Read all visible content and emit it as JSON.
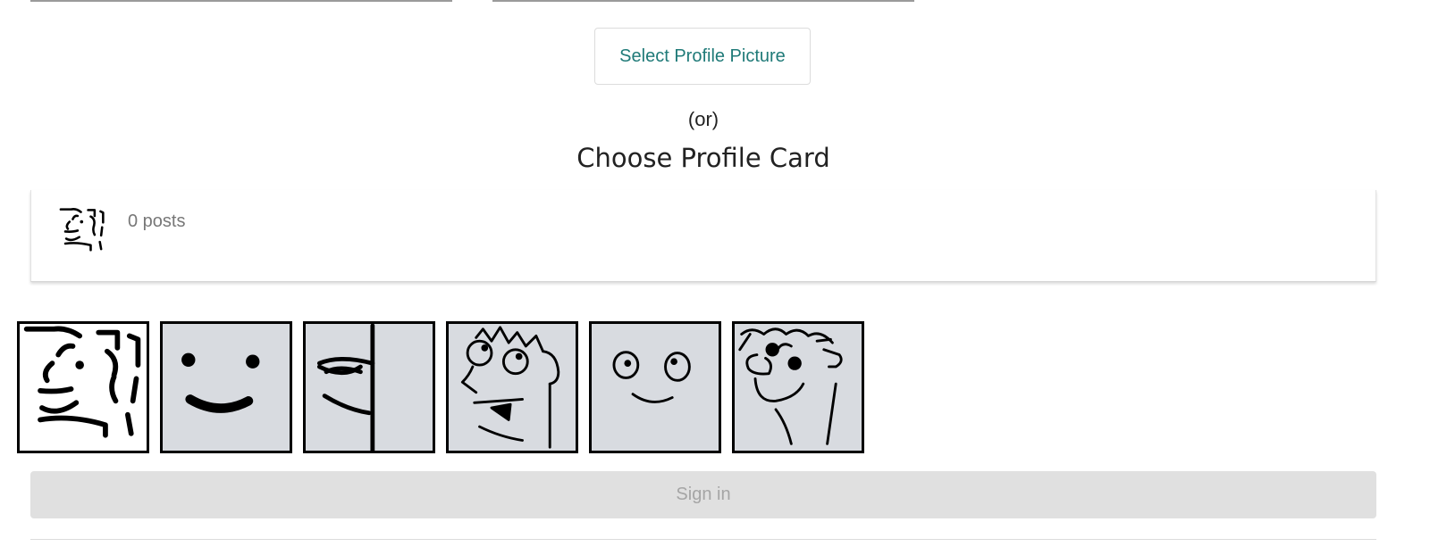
{
  "upload": {
    "button_label": "Select Profile Picture"
  },
  "divider": {
    "or_label": "(or)"
  },
  "cards": {
    "title": "Choose Profile Card",
    "preview": {
      "posts_label": "0 posts"
    },
    "options": [
      "face-1",
      "face-2",
      "face-3",
      "face-4",
      "face-5",
      "face-6"
    ],
    "selected_index": 0
  },
  "actions": {
    "sign_in_label": "Sign in"
  },
  "colors": {
    "accent": "#1f7a78",
    "tile_bg": "#d8dbe0",
    "tile_selected_bg": "#ffffff",
    "button_disabled_bg": "#e0e0e0",
    "button_disabled_text": "#a5a5a5"
  }
}
